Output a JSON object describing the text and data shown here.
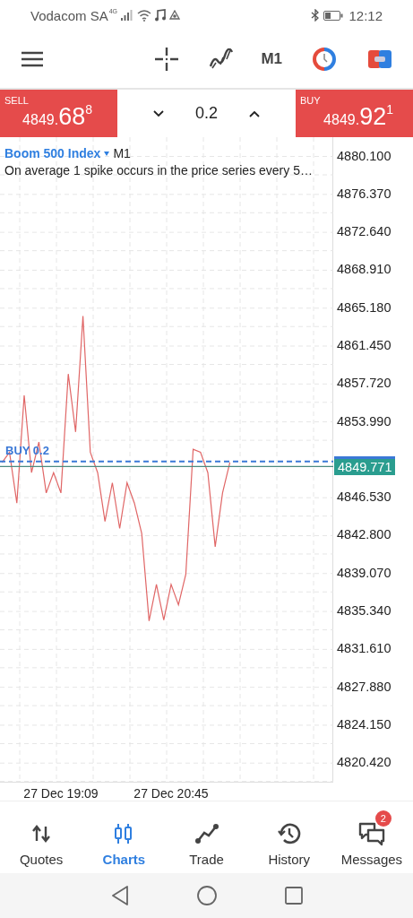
{
  "status_bar": {
    "carrier": "Vodacom SA",
    "network": "4G",
    "time": "12:12"
  },
  "toolbar": {
    "timeframe": "M1"
  },
  "trade_bar": {
    "sell": {
      "label": "SELL",
      "price_main": "4849.",
      "price_big": "68",
      "price_sup": "8"
    },
    "volume": "0.2",
    "buy": {
      "label": "BUY",
      "price_main": "4849.",
      "price_big": "92",
      "price_sup": "1"
    }
  },
  "chart": {
    "symbol": "Boom 500 Index",
    "timeframe": "M1",
    "description": "On average 1 spike occurs in the price series every 5…",
    "position_label": "BUY 0.2",
    "price_tag": "4849.771",
    "chart_data": {
      "type": "line",
      "categories": [
        null,
        null,
        null,
        null,
        null,
        null,
        null,
        null,
        "27 Dec 19:09",
        null,
        null,
        null,
        null,
        null,
        null,
        null,
        null,
        null,
        null,
        null,
        null,
        null,
        null,
        "27 Dec 20:45",
        null,
        null,
        null,
        null,
        null,
        null,
        null,
        null
      ],
      "series": [
        {
          "color": "#e06666",
          "values": [
            4850,
            4851,
            4846,
            4856.6,
            4849,
            4852,
            4847,
            4849,
            4847,
            4858.7,
            4853,
            4864.4,
            4851,
            4849,
            4844.2,
            4848,
            4843.5,
            4848,
            4846,
            4843,
            4834.4,
            4838,
            4834.5,
            4838,
            4836,
            4839,
            4851.3,
            4851,
            4849,
            4841.7,
            4847,
            4850
          ]
        }
      ],
      "grid": true,
      "ref_lines": [
        {
          "axis": "y",
          "value": 4849.921,
          "color": "#3a78d6"
        },
        {
          "axis": "y",
          "value": 4849.771,
          "color": "#4a8a80"
        }
      ],
      "ylim": [
        4818.5,
        4882
      ],
      "yticks": [
        {
          "value": 4880.1,
          "label": "4880.100"
        },
        {
          "value": 4876.37,
          "label": "4876.370"
        },
        {
          "value": 4872.64,
          "label": "4872.640"
        },
        {
          "value": 4868.91,
          "label": "4868.910"
        },
        {
          "value": 4865.18,
          "label": "4865.180"
        },
        {
          "value": 4861.45,
          "label": "4861.450"
        },
        {
          "value": 4857.72,
          "label": "4857.720"
        },
        {
          "value": 4853.99,
          "label": "4853.990"
        },
        {
          "value": 4846.53,
          "label": "4846.530"
        },
        {
          "value": 4842.8,
          "label": "4842.800"
        },
        {
          "value": 4839.07,
          "label": "4839.070"
        },
        {
          "value": 4835.34,
          "label": "4835.340"
        },
        {
          "value": 4831.61,
          "label": "4831.610"
        },
        {
          "value": 4827.88,
          "label": "4827.880"
        },
        {
          "value": 4824.15,
          "label": "4824.150"
        },
        {
          "value": 4820.42,
          "label": "4820.420"
        }
      ]
    }
  },
  "bottom_nav": [
    {
      "label": "Quotes",
      "selected": false
    },
    {
      "label": "Charts",
      "selected": true
    },
    {
      "label": "Trade",
      "selected": false
    },
    {
      "label": "History",
      "selected": false
    },
    {
      "label": "Messages",
      "selected": false,
      "badge": "2"
    }
  ]
}
